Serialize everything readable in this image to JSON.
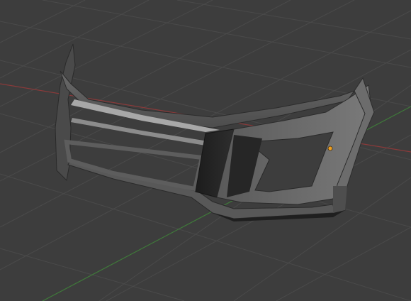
{
  "app": {
    "name": "3D viewport",
    "view": "perspective"
  },
  "viewport": {
    "background": "#3d3d3d",
    "grid_color": "#4a4a4a",
    "grid_visible": true
  },
  "axes": {
    "x_axis_color": "#8a3a3a",
    "y_axis_color": "#3f7a3a"
  },
  "object": {
    "kind": "front bumper mesh",
    "shading": "solid",
    "base_color": "#5e5e5e",
    "shadow_color": "#222222",
    "highlight_color": "#9a9a9a"
  },
  "origin_marker": {
    "color": "#f0a020",
    "visible": true
  }
}
